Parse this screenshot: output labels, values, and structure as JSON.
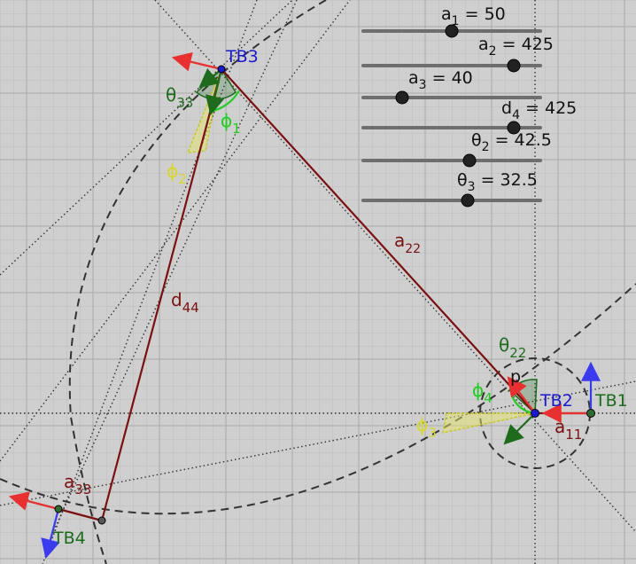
{
  "colors": {
    "background": "#cfcfcf",
    "grid_minor": "#bdbdbd",
    "grid_major": "#a8a8a8",
    "link_dark_red": "#7a1010",
    "angle_green": "#1e6b1e",
    "phi_green": "#22cc22",
    "phi_yellow": "#d8d82a",
    "point_blue": "#1a1acc",
    "arrow_red": "#e83030",
    "arrow_blue": "#3a3aee",
    "point_label_green": "#1a6b1a"
  },
  "points": {
    "tb1": "TB1",
    "tb2": "TB2",
    "tb3": "TB3",
    "tb4": "TB4",
    "p": "p"
  },
  "links": {
    "a11": {
      "base": "a",
      "sub": "11"
    },
    "a22": {
      "base": "a",
      "sub": "22"
    },
    "a33": {
      "base": "a",
      "sub": "33"
    },
    "d44": {
      "base": "d",
      "sub": "44"
    }
  },
  "angles": {
    "theta22": {
      "base": "θ",
      "sub": "22"
    },
    "theta33": {
      "base": "θ",
      "sub": "33"
    },
    "phi1": {
      "base": "ϕ",
      "sub": "1"
    },
    "phi2": {
      "base": "ϕ",
      "sub": "2"
    },
    "phi3": {
      "base": "ϕ",
      "sub": "3"
    },
    "phi4": {
      "base": "ϕ",
      "sub": "4"
    }
  },
  "sliders": [
    {
      "base": "a",
      "sub": "1",
      "value": "= 50",
      "fraction": 0.5
    },
    {
      "base": "a",
      "sub": "2",
      "value": "= 425",
      "fraction": 0.85
    },
    {
      "base": "a",
      "sub": "3",
      "value": "= 40",
      "fraction": 0.22
    },
    {
      "base": "d",
      "sub": "4",
      "value": "= 425",
      "fraction": 0.85
    },
    {
      "base": "θ",
      "sub": "2",
      "value": "= 42.5",
      "fraction": 0.6
    },
    {
      "base": "θ",
      "sub": "3",
      "value": "= 32.5",
      "fraction": 0.59
    }
  ]
}
